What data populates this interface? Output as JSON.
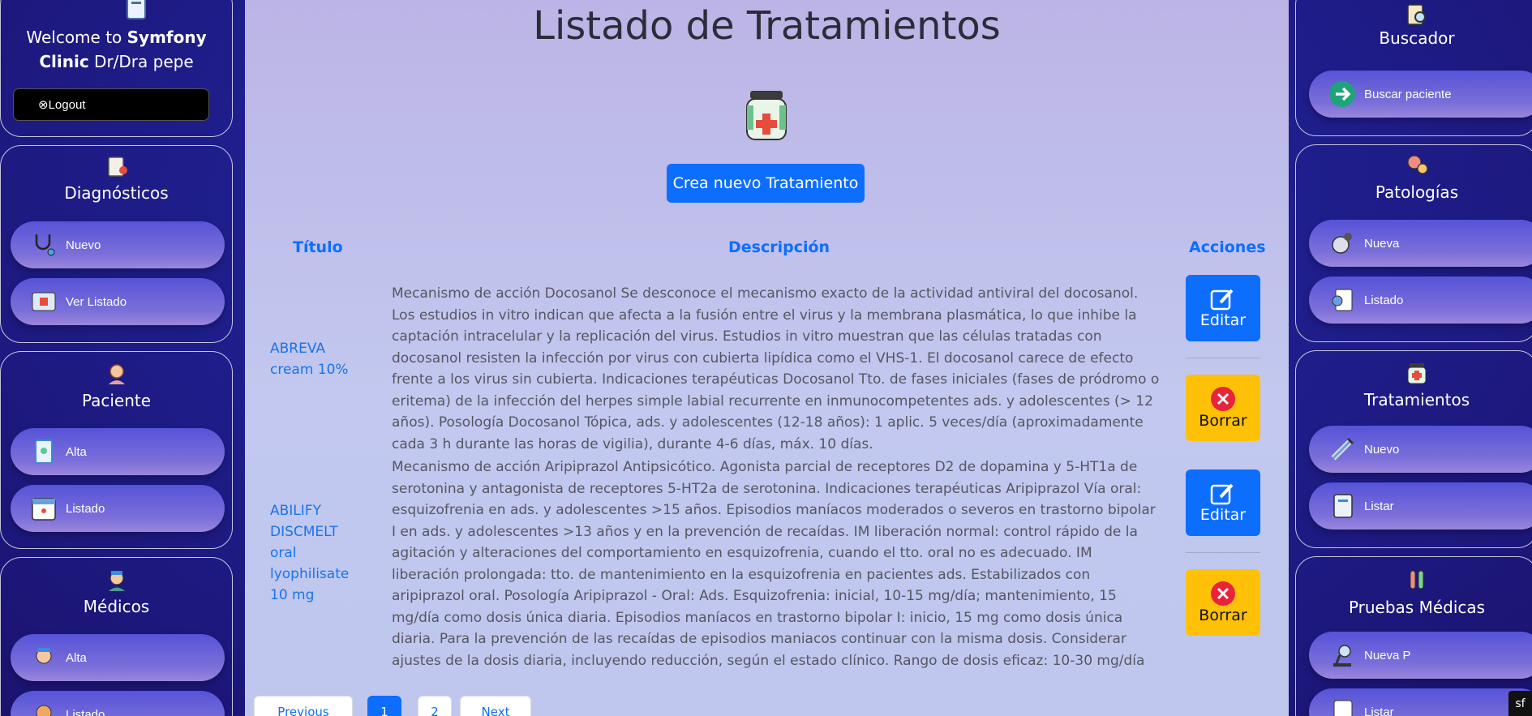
{
  "welcome": {
    "prefix": "Welcome to ",
    "brand": "Symfony Clinic",
    "suffix": " Dr/Dra pepe"
  },
  "logout_label": "⊗Logout",
  "left_sections": [
    {
      "title": "Diagnósticos",
      "items": [
        "Nuevo",
        "Ver Listado"
      ]
    },
    {
      "title": "Paciente",
      "items": [
        "Alta",
        "Listado"
      ]
    },
    {
      "title": "Médicos",
      "items": [
        "Alta",
        "Listado"
      ]
    }
  ],
  "right_sections": [
    {
      "title": "Buscador",
      "items": [
        "Buscar paciente"
      ]
    },
    {
      "title": "Patologías",
      "items": [
        "Nueva",
        "Listado"
      ]
    },
    {
      "title": "Tratamientos",
      "items": [
        "Nuevo",
        "Listar"
      ]
    },
    {
      "title": "Pruebas Médicas",
      "items": [
        "Nueva P",
        "Listar"
      ]
    }
  ],
  "main": {
    "title": "Listado de Tratamientos",
    "create_button": "Crea nuevo Tratamiento",
    "headers": {
      "title": "Título",
      "description": "Descripción",
      "actions": "Acciones"
    },
    "edit_label": "Editar",
    "delete_label": "Borrar",
    "rows": [
      {
        "title": "ABREVA cream 10%",
        "description": "Mecanismo de acción Docosanol Se desconoce el mecanismo exacto de la actividad antiviral del docosanol. Los estudios in vitro indican que afecta a la fusión entre el virus y la membrana plasmática, lo que inhibe la captación intracelular y la replicación del virus. Estudios in vitro muestran que las células tratadas con docosanol resisten la infección por virus con cubierta lipídica como el VHS-1. El docosanol carece de efecto frente a los virus sin cubierta. Indicaciones terapéuticas Docosanol Tto. de fases iniciales (fases de pródromo o eritema) de la infección del herpes simple labial recurrente en inmunocompetentes ads. y adolescentes (> 12 años). Posología Docosanol Tópica, ads. y adolescentes (12-18 años): 1 aplic. 5 veces/día (aproximadamente cada 3 h durante las horas de vigilia), durante 4-6 días, máx. 10 días."
      },
      {
        "title": "ABILIFY DISCMELT oral lyophilisate 10 mg",
        "description": "Mecanismo de acción Aripiprazol Antipsicótico. Agonista parcial de receptores D2 de dopamina y 5-HT1a de serotonina y antagonista de receptores 5-HT2a de serotonina. Indicaciones terapéuticas Aripiprazol Vía oral: esquizofrenia en ads. y adolescentes >15 años. Episodios maníacos moderados o severos en trastorno bipolar I en ads. y adolescentes >13 años y en la prevención de recaídas. IM liberación normal: control rápido de la agitación y alteraciones del comportamiento en esquizofrenia, cuando el tto. oral no es adecuado. IM liberación prolongada: tto. de mantenimiento en la esquizofrenia en pacientes ads. Estabilizados con aripiprazol oral. Posología Aripiprazol - Oral: Ads. Esquizofrenia: inicial, 10-15 mg/día; mantenimiento, 15 mg/día como dosis única diaria. Episodios maníacos en trastorno bipolar I: inicio, 15 mg como dosis única diaria. Para la prevención de las recaídas de episodios maniacos continuar con la misma dosis. Considerar ajustes de la dosis diaria, incluyendo reducción, según el estado clínico. Rango de dosis eficaz: 10-30 mg/día"
      }
    ],
    "pagination": [
      "Previous",
      "1",
      "2",
      "Next"
    ]
  },
  "symfony_badge": "sf"
}
